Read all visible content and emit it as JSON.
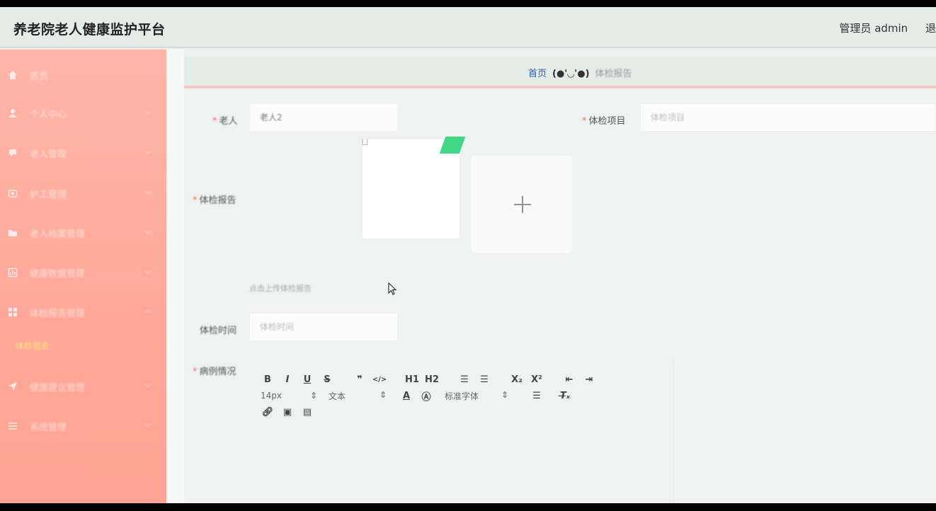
{
  "app": {
    "title": "养老院老人健康监护平台",
    "user_label": "管理员 admin",
    "logout_label": "退"
  },
  "sidebar": {
    "items": [
      {
        "label": "首页",
        "icon": "home-icon"
      },
      {
        "label": "个人中心",
        "icon": "user-icon"
      },
      {
        "label": "老人管理",
        "icon": "person-icon"
      },
      {
        "label": "护工管理",
        "icon": "nurse-icon"
      },
      {
        "label": "老人档案管理",
        "icon": "folder-icon"
      },
      {
        "label": "健康数据管理",
        "icon": "chart-icon"
      },
      {
        "label": "体检报告管理",
        "icon": "grid-icon"
      },
      {
        "label": "健康建议管理",
        "icon": "send-icon"
      },
      {
        "label": "系统管理",
        "icon": "list-icon"
      }
    ],
    "active_sub": "体检报告"
  },
  "breadcrumb": {
    "home": "首页",
    "separator": "(●'◡'●)",
    "current": "体检报告"
  },
  "form": {
    "elder_label": "老人",
    "elder_value": "老人2",
    "item_label": "体检项目",
    "item_placeholder": "体检项目",
    "report_label": "体检报告",
    "upload_tip": "点击上传体检报告",
    "time_label": "体检时间",
    "time_placeholder": "体检时间",
    "detail_label": "病例情况"
  },
  "editor": {
    "row1": [
      "B",
      "I",
      "U",
      "S",
      "❞",
      "</>",
      "H1",
      "H2",
      "☰",
      "☰",
      "X₂",
      "X²",
      "⇤",
      "⇥"
    ],
    "font_size": "14px",
    "text_type": "文本",
    "font_family": "标准字体"
  }
}
